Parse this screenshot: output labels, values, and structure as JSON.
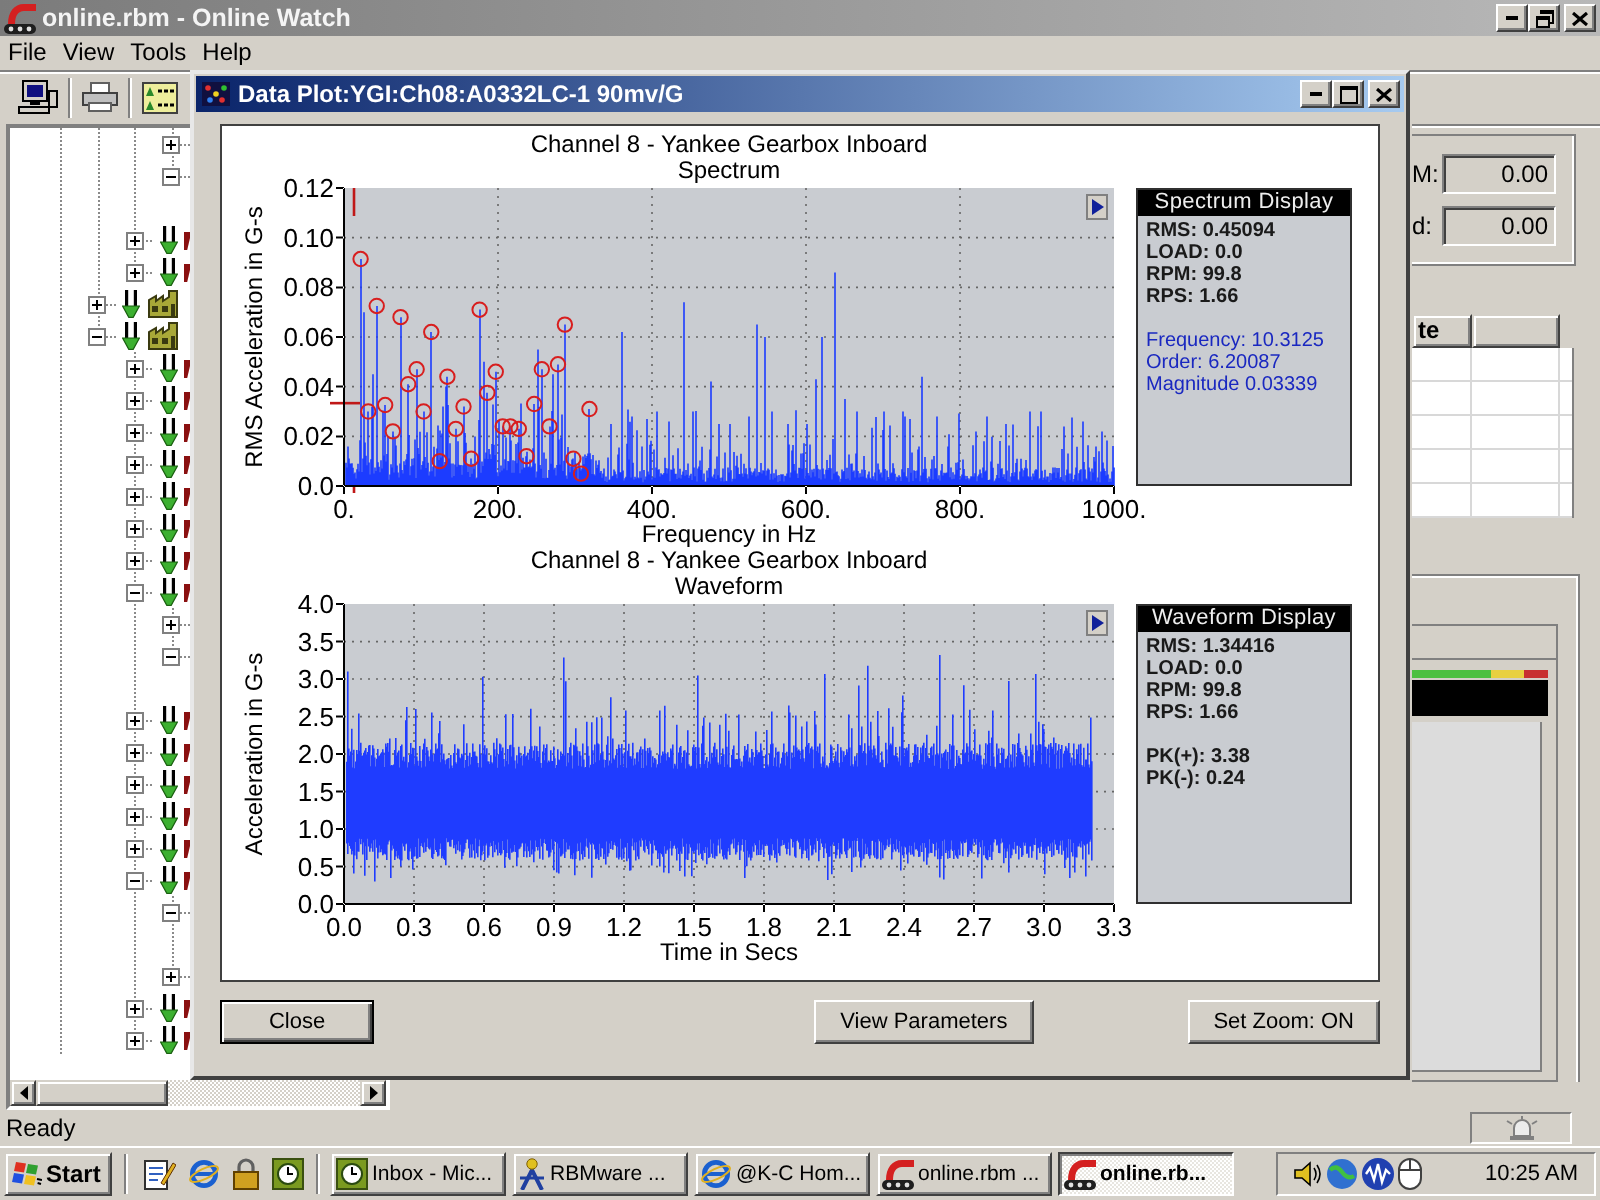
{
  "window": {
    "title": "online.rbm - Online Watch"
  },
  "menu": [
    "File",
    "View",
    "Tools",
    "Help"
  ],
  "tree": {
    "items": [
      {
        "children": [
          {
            "children": [
              {
                "kind": "point",
                "expanded": false
              },
              {
                "kind": "point",
                "expanded": true
              }
            ]
          },
          {
            "kind": "probe",
            "expanded": false
          },
          {
            "kind": "probe",
            "expanded": false
          }
        ]
      },
      {
        "kind": "machine",
        "expanded": false
      },
      {
        "kind": "machine",
        "expanded": true,
        "children": [
          {
            "kind": "probe",
            "expanded": false
          },
          {
            "kind": "probe",
            "expanded": false
          },
          {
            "kind": "probe",
            "expanded": false
          },
          {
            "kind": "probe",
            "expanded": false
          },
          {
            "kind": "probe",
            "expanded": false
          },
          {
            "kind": "probe",
            "expanded": false
          },
          {
            "kind": "probe",
            "expanded": false
          },
          {
            "kind": "probe",
            "expanded": true,
            "children": [
              {
                "kind": "point",
                "expanded": false
              },
              {
                "kind": "point",
                "expanded": true
              }
            ]
          },
          {
            "kind": "probe",
            "expanded": false
          },
          {
            "kind": "probe",
            "expanded": false
          },
          {
            "kind": "probe",
            "expanded": false
          },
          {
            "kind": "probe",
            "expanded": false
          },
          {
            "kind": "probe",
            "expanded": false
          },
          {
            "kind": "probe",
            "expanded": true,
            "children": [
              {
                "kind": "point",
                "expanded": true
              },
              {
                "kind": "point",
                "expanded": false
              }
            ]
          },
          {
            "kind": "probe",
            "expanded": false
          },
          {
            "kind": "probe",
            "expanded": false
          }
        ]
      }
    ]
  },
  "side_panel": {
    "fields": [
      {
        "label": "M:",
        "value": "0.00"
      },
      {
        "label": "d:",
        "value": "0.00"
      }
    ],
    "table": {
      "columns": [
        "te"
      ]
    }
  },
  "dialog": {
    "title": "Data Plot:YGI:Ch08:A0332LC-1 90mv/G",
    "plots": [
      {
        "kind": "spectrum",
        "title": "Channel 8 - Yankee Gearbox Inboard",
        "subtitle": "Spectrum",
        "ylabel": "RMS Acceleration in G-s",
        "xlabel": "Frequency in Hz",
        "yticks": [
          "0.12",
          "0.10",
          "0.08",
          "0.06",
          "0.04",
          "0.02",
          "0.0"
        ],
        "xticks": [
          "0.",
          "200.",
          "400.",
          "600.",
          "800.",
          "1000."
        ],
        "display": {
          "title": "Spectrum Display",
          "groups": [
            {
              "kind": "readings",
              "lines": [
                "RMS: 0.45094",
                "LOAD: 0.0",
                "RPM: 99.8",
                "RPS: 1.66"
              ]
            },
            {
              "kind": "cursor",
              "lines": [
                "Frequency: 10.3125",
                "Order: 6.20087",
                "Magnitude 0.03339"
              ]
            }
          ]
        }
      },
      {
        "kind": "waveform",
        "title": "Channel 8 - Yankee Gearbox Inboard",
        "subtitle": "Waveform",
        "ylabel": "Acceleration in G-s",
        "xlabel": "Time in Secs",
        "yticks": [
          "4.0",
          "3.5",
          "3.0",
          "2.5",
          "2.0",
          "1.5",
          "1.0",
          "0.5",
          "0.0"
        ],
        "xticks": [
          "0.0",
          "0.3",
          "0.6",
          "0.9",
          "1.2",
          "1.5",
          "1.8",
          "2.1",
          "2.4",
          "2.7",
          "3.0",
          "3.3"
        ],
        "display": {
          "title": "Waveform Display",
          "groups": [
            {
              "kind": "readings",
              "lines": [
                "RMS: 1.34416",
                "LOAD: 0.0",
                "RPM: 99.8",
                "RPS: 1.66"
              ]
            },
            {
              "kind": "peaks",
              "lines": [
                "PK(+): 3.38",
                "PK(-): 0.24"
              ]
            }
          ]
        }
      }
    ],
    "buttons": [
      {
        "label": "Close",
        "default": true
      },
      {
        "label": "View Parameters",
        "default": false
      },
      {
        "label": "Set Zoom: ON",
        "default": false
      }
    ]
  },
  "status_bar": {
    "text": "Ready"
  },
  "taskbar": {
    "start": "Start",
    "tasks": [
      {
        "label": "Inbox - Mic...",
        "kind": "mail",
        "selected": false
      },
      {
        "label": "RBMware ...",
        "kind": "app",
        "selected": false
      },
      {
        "label": "@K-C Hom...",
        "kind": "browser",
        "selected": false
      },
      {
        "label": "online.rbm ...",
        "kind": "monitor",
        "selected": false
      },
      {
        "label": "online.rb...",
        "kind": "monitor",
        "selected": true
      }
    ],
    "clock": "10:25 AM"
  }
}
